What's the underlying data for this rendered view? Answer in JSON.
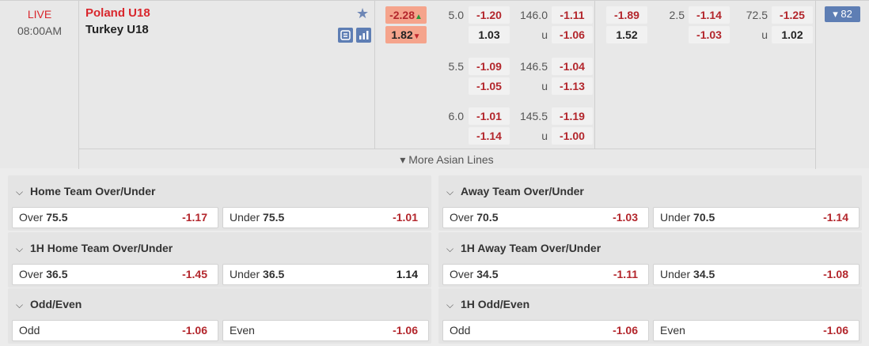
{
  "match": {
    "status": "LIVE",
    "time": "08:00AM",
    "home_team": "Poland U18",
    "away_team": "Turkey U18",
    "more_lines_label": "More Asian Lines",
    "more_markets_count": "82",
    "moneyline": {
      "home": "-2.28",
      "away": "1.82"
    },
    "handicap_rows": [
      {
        "line": "5.0",
        "home_odds": "-1.20",
        "away_odds": "1.03",
        "total": "146.0",
        "over_odds": "-1.11",
        "under_label": "u",
        "under_odds": "-1.06"
      },
      {
        "line": "5.5",
        "home_odds": "-1.09",
        "away_odds": "-1.05",
        "total": "146.5",
        "over_odds": "-1.04",
        "under_label": "u",
        "under_odds": "-1.13"
      },
      {
        "line": "6.0",
        "home_odds": "-1.01",
        "away_odds": "-1.14",
        "total": "145.5",
        "over_odds": "-1.19",
        "under_label": "u",
        "under_odds": "-1.00"
      }
    ],
    "first_half": {
      "ml_home": "-1.89",
      "ml_away": "1.52",
      "line": "2.5",
      "home_odds": "-1.14",
      "away_odds": "-1.03",
      "total": "72.5",
      "over_odds": "-1.25",
      "under_label": "u",
      "under_odds": "1.02"
    }
  },
  "markets": [
    {
      "title": "Home Team Over/Under",
      "options": [
        {
          "label": "Over",
          "line": "75.5",
          "odds": "-1.17"
        },
        {
          "label": "Under",
          "line": "75.5",
          "odds": "-1.01"
        }
      ]
    },
    {
      "title": "Away Team Over/Under",
      "options": [
        {
          "label": "Over",
          "line": "70.5",
          "odds": "-1.03"
        },
        {
          "label": "Under",
          "line": "70.5",
          "odds": "-1.14"
        }
      ]
    },
    {
      "title": "1H Home Team Over/Under",
      "options": [
        {
          "label": "Over",
          "line": "36.5",
          "odds": "-1.45"
        },
        {
          "label": "Under",
          "line": "36.5",
          "odds": "1.14"
        }
      ]
    },
    {
      "title": "1H Away Team Over/Under",
      "options": [
        {
          "label": "Over",
          "line": "34.5",
          "odds": "-1.11"
        },
        {
          "label": "Under",
          "line": "34.5",
          "odds": "-1.08"
        }
      ]
    },
    {
      "title": "Odd/Even",
      "options": [
        {
          "label": "Odd",
          "line": "",
          "odds": "-1.06"
        },
        {
          "label": "Even",
          "line": "",
          "odds": "-1.06"
        }
      ]
    },
    {
      "title": "1H Odd/Even",
      "options": [
        {
          "label": "Odd",
          "line": "",
          "odds": "-1.06"
        },
        {
          "label": "Even",
          "line": "",
          "odds": "-1.06"
        }
      ]
    }
  ],
  "icons": {
    "favorite": "star-icon",
    "stats": "stats-icon",
    "chart": "bar-chart-icon",
    "expand": "chevron-down-icon"
  },
  "colors": {
    "live": "#d9262c",
    "negative_odds": "#b3262c",
    "accent": "#5e7eb4",
    "highlight": "#f5a48c"
  }
}
